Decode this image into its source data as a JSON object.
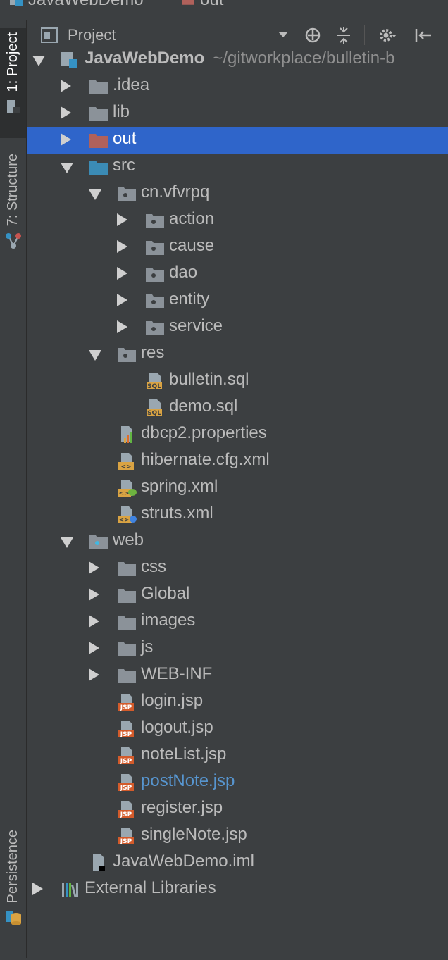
{
  "breadcrumb": {
    "items": [
      "JavaWebDemo",
      "out"
    ]
  },
  "sidebar": {
    "tabs": [
      "1: Project",
      "7: Structure",
      "Persistence"
    ]
  },
  "panel": {
    "title": "Project"
  },
  "tree": [
    {
      "label": "JavaWebDemo",
      "path": "~/gitworkplace/bulletin-b",
      "level": 0,
      "arrow": "down",
      "icon": "module-icon",
      "bold": true
    },
    {
      "label": ".idea",
      "level": 1,
      "arrow": "right",
      "icon": "folder-icon"
    },
    {
      "label": "lib",
      "level": 1,
      "arrow": "right",
      "icon": "folder-icon"
    },
    {
      "label": "out",
      "level": 1,
      "arrow": "right",
      "icon": "excluded-folder-icon",
      "selected": true
    },
    {
      "label": "src",
      "level": 1,
      "arrow": "down",
      "icon": "source-folder-icon"
    },
    {
      "label": "cn.vfvrpq",
      "level": 2,
      "arrow": "down",
      "icon": "package-icon"
    },
    {
      "label": "action",
      "level": 3,
      "arrow": "right",
      "icon": "package-icon"
    },
    {
      "label": "cause",
      "level": 3,
      "arrow": "right",
      "icon": "package-icon"
    },
    {
      "label": "dao",
      "level": 3,
      "arrow": "right",
      "icon": "package-icon"
    },
    {
      "label": "entity",
      "level": 3,
      "arrow": "right",
      "icon": "package-icon"
    },
    {
      "label": "service",
      "level": 3,
      "arrow": "right",
      "icon": "package-icon"
    },
    {
      "label": "res",
      "level": 2,
      "arrow": "down",
      "icon": "package-icon"
    },
    {
      "label": "bulletin.sql",
      "level": 3,
      "arrow": "none",
      "icon": "sql-file-icon"
    },
    {
      "label": "demo.sql",
      "level": 3,
      "arrow": "none",
      "icon": "sql-file-icon"
    },
    {
      "label": "dbcp2.properties",
      "level": 2,
      "arrow": "none",
      "icon": "properties-file-icon"
    },
    {
      "label": "hibernate.cfg.xml",
      "level": 2,
      "arrow": "none",
      "icon": "xml-file-icon"
    },
    {
      "label": "spring.xml",
      "level": 2,
      "arrow": "none",
      "icon": "spring-xml-file-icon"
    },
    {
      "label": "struts.xml",
      "level": 2,
      "arrow": "none",
      "icon": "struts-xml-file-icon"
    },
    {
      "label": "web",
      "level": 1,
      "arrow": "down",
      "icon": "web-folder-icon"
    },
    {
      "label": "css",
      "level": 2,
      "arrow": "right",
      "icon": "folder-icon"
    },
    {
      "label": "Global",
      "level": 2,
      "arrow": "right",
      "icon": "folder-icon"
    },
    {
      "label": "images",
      "level": 2,
      "arrow": "right",
      "icon": "folder-icon"
    },
    {
      "label": "js",
      "level": 2,
      "arrow": "right",
      "icon": "folder-icon"
    },
    {
      "label": "WEB-INF",
      "level": 2,
      "arrow": "right",
      "icon": "folder-icon"
    },
    {
      "label": "login.jsp",
      "level": 2,
      "arrow": "none",
      "icon": "jsp-file-icon"
    },
    {
      "label": "logout.jsp",
      "level": 2,
      "arrow": "none",
      "icon": "jsp-file-icon"
    },
    {
      "label": "noteList.jsp",
      "level": 2,
      "arrow": "none",
      "icon": "jsp-file-icon"
    },
    {
      "label": "postNote.jsp",
      "level": 2,
      "arrow": "none",
      "icon": "jsp-file-icon",
      "modified": true
    },
    {
      "label": "register.jsp",
      "level": 2,
      "arrow": "none",
      "icon": "jsp-file-icon"
    },
    {
      "label": "singleNote.jsp",
      "level": 2,
      "arrow": "none",
      "icon": "jsp-file-icon"
    },
    {
      "label": "JavaWebDemo.iml",
      "level": 1,
      "arrow": "none",
      "icon": "iml-file-icon"
    },
    {
      "label": "External Libraries",
      "level": 0,
      "arrow": "right",
      "icon": "libraries-icon"
    }
  ]
}
